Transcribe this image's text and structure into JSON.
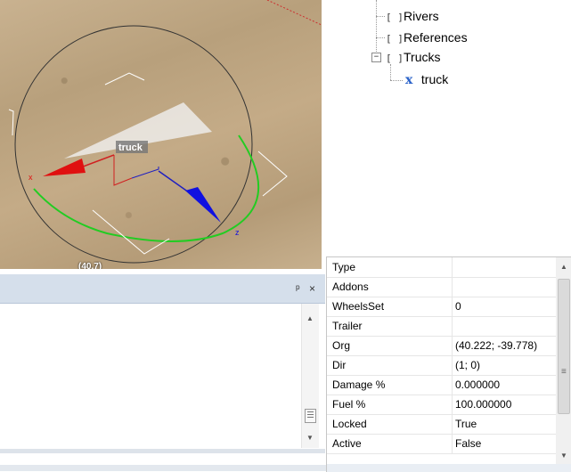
{
  "viewport": {
    "object_label": "truck",
    "axis_x": "x",
    "axis_z": "z",
    "coord_readout": "(40.7)"
  },
  "tree": {
    "items": [
      {
        "label": "Rivers",
        "icon": "bracket-node-icon"
      },
      {
        "label": "References",
        "icon": "bracket-node-icon"
      },
      {
        "label": "Trucks",
        "icon": "bracket-node-icon",
        "expander": "−"
      },
      {
        "label": "truck",
        "icon": "x-object-icon",
        "icon_glyph": "x"
      }
    ]
  },
  "dock": {
    "pin_glyph": "ᵖ",
    "close_glyph": "×"
  },
  "properties": {
    "rows": [
      {
        "name": "Type",
        "value": ""
      },
      {
        "name": "Addons",
        "value": ""
      },
      {
        "name": "WheelsSet",
        "value": "0"
      },
      {
        "name": "Trailer",
        "value": ""
      },
      {
        "name": "Org",
        "value": "(40.222; -39.778)"
      },
      {
        "name": "Dir",
        "value": "(1; 0)"
      },
      {
        "name": "Damage %",
        "value": "0.000000"
      },
      {
        "name": "Fuel %",
        "value": "100.000000"
      },
      {
        "name": "Locked",
        "value": "True"
      },
      {
        "name": "Active",
        "value": "False"
      }
    ]
  },
  "colors": {
    "gizmo_x": "#e01010",
    "gizmo_z": "#1010e0",
    "ring_green": "#22cc22",
    "panel_header": "#d5dfeb"
  }
}
